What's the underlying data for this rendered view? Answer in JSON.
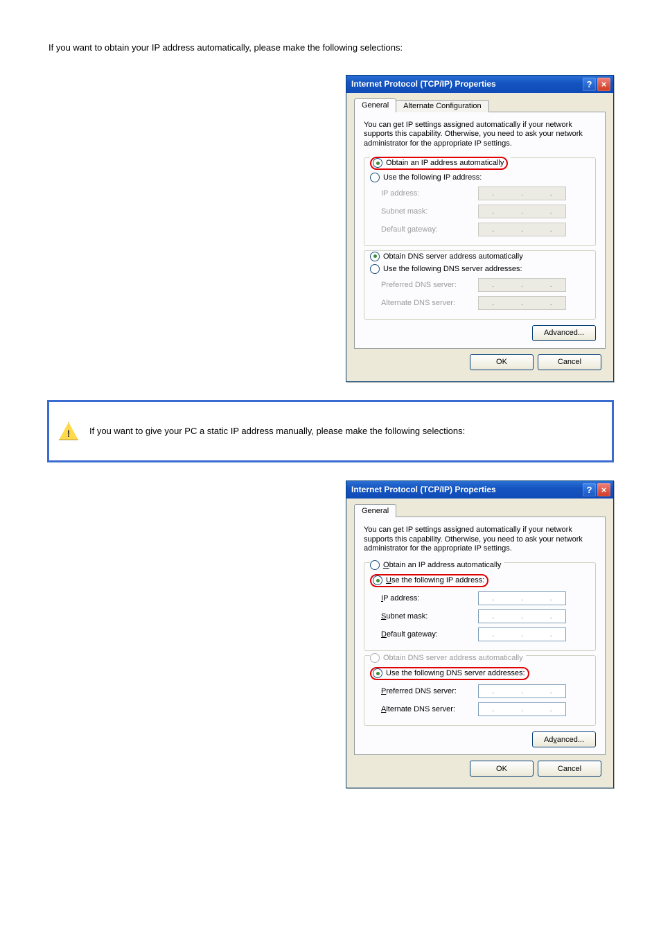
{
  "page": {
    "lead": "If you want to obtain your IP address automatically, please make the following selections:"
  },
  "dialog1": {
    "title": "Internet Protocol (TCP/IP) Properties",
    "tabs": {
      "general": "General",
      "alt": "Alternate Configuration"
    },
    "desc": "You can get IP settings assigned automatically if your network supports this capability. Otherwise, you need to ask your network administrator for the appropriate IP settings.",
    "ip_auto": "Obtain an IP address automatically",
    "ip_manual": "Use the following IP address:",
    "ip_addr": "IP address:",
    "subnet": "Subnet mask:",
    "gateway": "Default gateway:",
    "dns_auto": "Obtain DNS server address automatically",
    "dns_manual": "Use the following DNS server addresses:",
    "pref_dns": "Preferred DNS server:",
    "alt_dns": "Alternate DNS server:",
    "adv": "Advanced...",
    "ok": "OK",
    "cancel": "Cancel"
  },
  "note": "If you want to give your PC a static IP address manually, please make the following selections:",
  "dialog2": {
    "title": "Internet Protocol (TCP/IP) Properties",
    "tabs": {
      "general": "General"
    },
    "desc": "You can get IP settings assigned automatically if your network supports this capability. Otherwise, you need to ask your network administrator for the appropriate IP settings.",
    "ip_auto_pre": "O",
    "ip_auto_mid": "btain an IP address automatically",
    "ip_manual_pre": "U",
    "ip_manual_mid": "se the following IP address:",
    "ip_addr_pre": "I",
    "ip_addr_mid": "P address:",
    "subnet_pre": "S",
    "subnet_mid": "ubnet mask:",
    "gateway_pre": "D",
    "gateway_mid": "efault gateway:",
    "dns_auto_pre": "",
    "dns_auto_mid": "Obtain DNS server address automatically",
    "dns_manual_pre": "",
    "dns_manual_mid": "Use the following DNS server addresses:",
    "pref_dns_pre": "P",
    "pref_dns_mid": "referred DNS server:",
    "alt_dns_pre": "A",
    "alt_dns_mid": "lternate DNS server:",
    "adv_pre": "Ad",
    "adv_u": "v",
    "adv_post": "anced...",
    "ok": "OK",
    "cancel": "Cancel"
  }
}
